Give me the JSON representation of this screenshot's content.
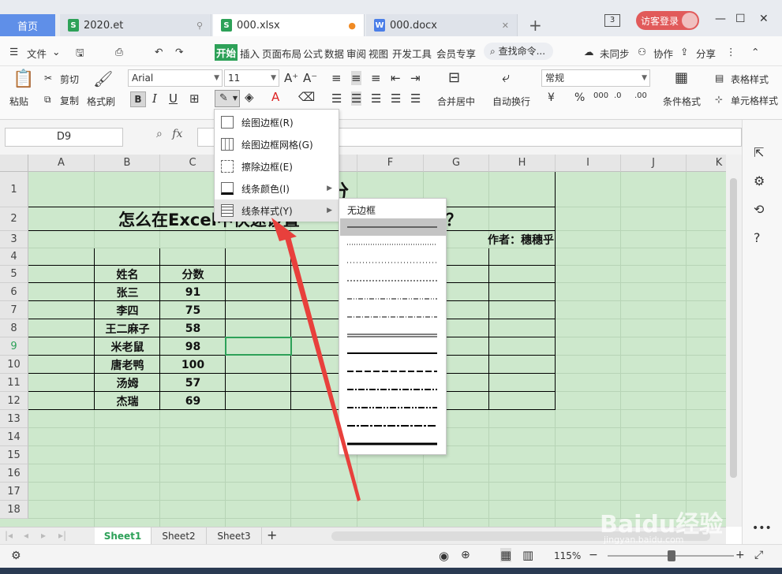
{
  "tabs": {
    "home": "首页",
    "docs": [
      {
        "name": "2020.et",
        "letter": "S",
        "color": "#2da158"
      },
      {
        "name": "000.xlsx",
        "letter": "S",
        "color": "#2da158"
      },
      {
        "name": "000.docx",
        "letter": "W",
        "color": "#4a7ee8"
      }
    ],
    "window_count": "3",
    "login": "访客登录"
  },
  "menu": {
    "file": "文件",
    "items": [
      "开始",
      "插入",
      "页面布局",
      "公式",
      "数据",
      "审阅",
      "视图",
      "开发工具",
      "会员专享"
    ],
    "search": "查找命令...",
    "sync": "未同步",
    "collab": "协作",
    "share": "分享"
  },
  "ribbon": {
    "paste": "粘贴",
    "cut": "剪切",
    "copy": "复制",
    "format_painter": "格式刷",
    "font": "Arial",
    "size": "11",
    "number_format": "常规",
    "merge_center": "合并居中",
    "auto_wrap": "自动换行",
    "cond_format": "条件格式",
    "table_style": "表格样式",
    "cell_style": "单元格样式"
  },
  "formula_bar": {
    "name_box": "D9",
    "fx": "fx"
  },
  "grid": {
    "columns": [
      "A",
      "B",
      "C",
      "D",
      "E",
      "F",
      "G",
      "H",
      "I",
      "J",
      "K"
    ],
    "rows": [
      "1",
      "2",
      "3",
      "4",
      "5",
      "6",
      "7",
      "8",
      "9",
      "10",
      "11",
      "12",
      "13",
      "14",
      "15",
      "16",
      "17",
      "18"
    ],
    "selected_row": "9",
    "title_char": "分",
    "subtitle": "怎么在Excel中快速设置",
    "subtitle_tail": "？",
    "author": "作者：穗穗乎",
    "header_name": "姓名",
    "header_score": "分数",
    "data": [
      {
        "name": "张三",
        "score": "91"
      },
      {
        "name": "李四",
        "score": "75"
      },
      {
        "name": "王二麻子",
        "score": "58"
      },
      {
        "name": "米老鼠",
        "score": "98"
      },
      {
        "name": "唐老鸭",
        "score": "100"
      },
      {
        "name": "汤姆",
        "score": "57"
      },
      {
        "name": "杰瑞",
        "score": "69"
      }
    ]
  },
  "context_menu": {
    "items": [
      "绘图边框(R)",
      "绘图边框网格(G)",
      "擦除边框(E)",
      "线条颜色(I)",
      "线条样式(Y)"
    ]
  },
  "line_style_menu": {
    "none": "无边框"
  },
  "sheets": [
    "Sheet1",
    "Sheet2",
    "Sheet3"
  ],
  "status": {
    "zoom": "115%"
  },
  "watermark": {
    "text": "Baidu经验",
    "sub": "jingyan.baidu.com"
  }
}
